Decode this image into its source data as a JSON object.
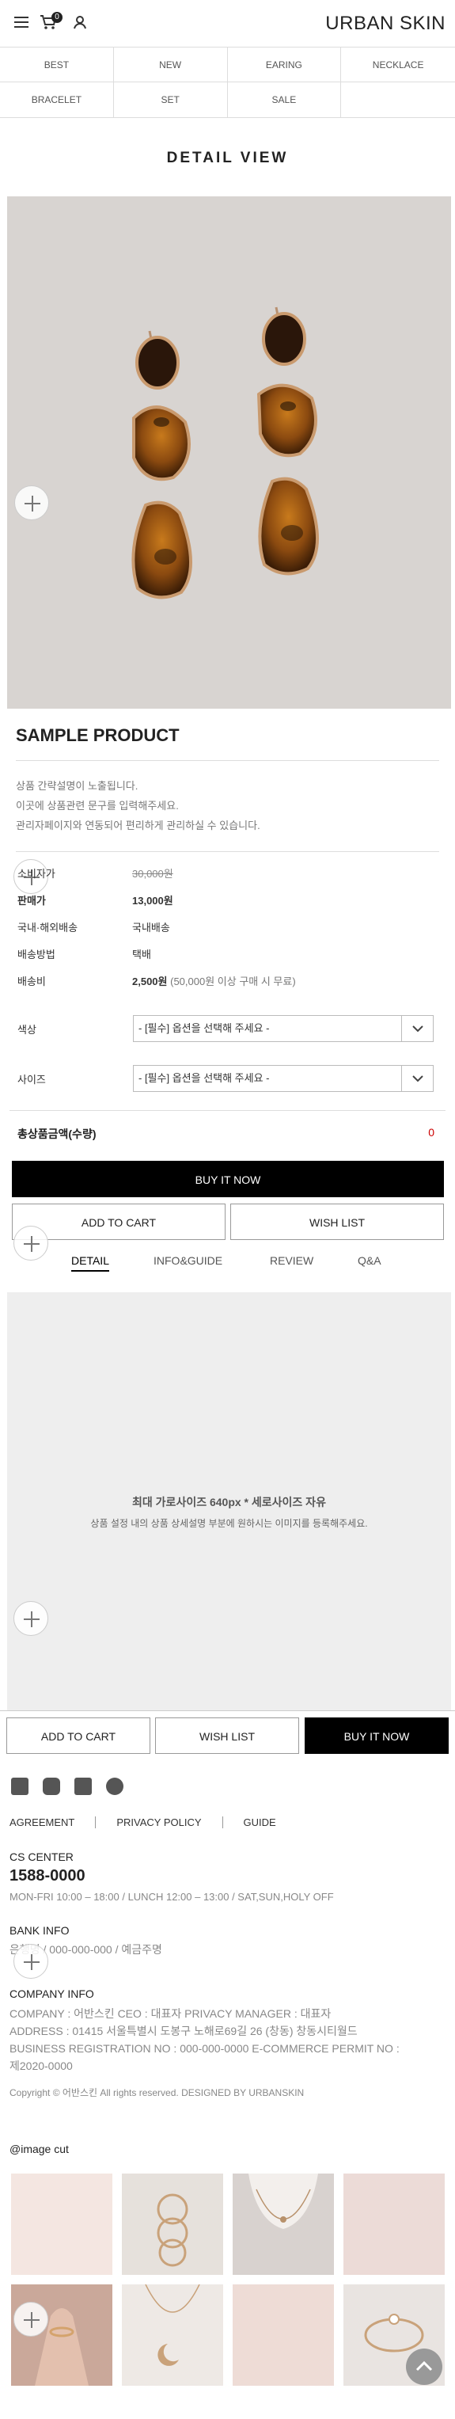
{
  "header": {
    "brand": "URBAN SKIN",
    "cart_count": "0",
    "icons": [
      "menu-icon",
      "cart-icon",
      "user-icon"
    ]
  },
  "categories": [
    "BEST",
    "NEW",
    "EARING",
    "NECKLACE",
    "BRACELET",
    "SET",
    "SALE",
    ""
  ],
  "page_title": "DETAIL VIEW",
  "product": {
    "name": "SAMPLE PRODUCT",
    "description": [
      "상품 간략설명이 노출됩니다.",
      "이곳에 상품관련 문구를 입력해주세요.",
      "관리자페이지와 연동되어 편리하게 관리하실 수 있습니다."
    ],
    "info": [
      {
        "label": "소비자가",
        "value": "30,000원"
      },
      {
        "label": "판매가",
        "value": "13,000원"
      },
      {
        "label": "국내·해외배송",
        "value": "국내배송"
      },
      {
        "label": "배송방법",
        "value": "택배"
      },
      {
        "label": "배송비",
        "value": "2,500원",
        "extra": "(50,000원 이상 구매 시 무료)"
      }
    ],
    "options": [
      {
        "label": "색상",
        "value": "- [필수] 옵션을 선택해 주세요 -"
      },
      {
        "label": "사이즈",
        "value": "- [필수] 옵션을 선택해 주세요 -"
      }
    ],
    "total_label": "총상품금액(수량)",
    "total_value": "0"
  },
  "buttons": {
    "buy_now": "BUY IT NOW",
    "add_to_cart": "ADD TO CART",
    "wish_list": "WISH LIST"
  },
  "tabs": [
    "DETAIL",
    "INFO&GUIDE",
    "REVIEW",
    "Q&A"
  ],
  "detail_box": {
    "line1": "최대 가로사이즈 640px * 세로사이즈 자유",
    "line2": "상품 설정 내의 상품 상세설명 부분에 원하시는 이미지를 등록해주세요."
  },
  "bottom_bar": {
    "add_to_cart": "ADD TO CART",
    "wish_list": "WISH LIST",
    "buy_now": "BUY IT NOW"
  },
  "footer": {
    "social_icons": [
      "facebook-icon",
      "instagram-icon",
      "blog-icon",
      "kakao-icon"
    ],
    "links": [
      "AGREEMENT",
      "PRIVACY POLICY",
      "GUIDE"
    ],
    "cs_title": "CS CENTER",
    "cs_phone": "1588-0000",
    "cs_hours": "MON-FRI 10:00 – 18:00 / LUNCH 12:00 – 13:00 / SAT,SUN,HOLY OFF",
    "bank_title": "BANK INFO",
    "bank_text": "은행명 / 000-000-000 / 예금주명",
    "company_title": "COMPANY INFO",
    "company_lines": [
      "COMPANY : 어반스킨 CEO : 대표자 PRIVACY MANAGER : 대표자",
      "ADDRESS : 01415 서울특별시 도봉구 노해로69길 26 (창동) 창동시티월드",
      "BUSINESS REGISTRATION NO : 000-000-0000 E-COMMERCE PERMIT NO :",
      "제2020-0000"
    ],
    "copyright": "Copyright © 어반스킨 All rights reserved. DESIGNED BY URBANSKIN",
    "gallery_title": "@image cut"
  }
}
